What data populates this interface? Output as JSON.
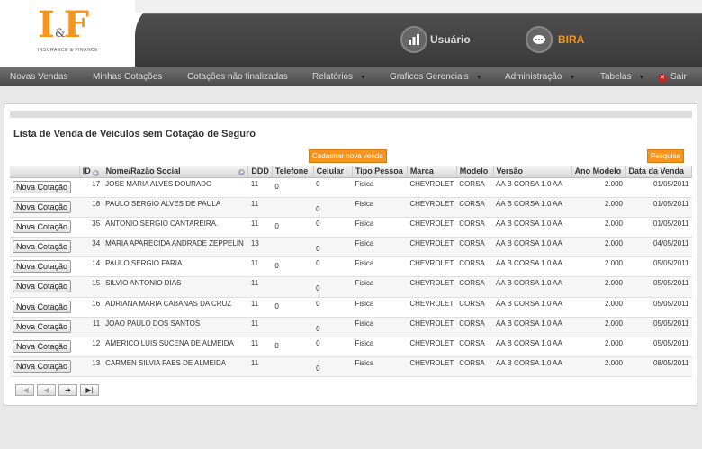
{
  "logo": {
    "mark": "I F",
    "amp": "&",
    "sub": "INSURANCE & FINANCE"
  },
  "header": {
    "user_label": "Usuário",
    "user_name": "BIRA",
    "user_icon": "bar-chart-icon",
    "chat_icon": "chat-bubble-icon",
    "accent": "#f7941d"
  },
  "menu": {
    "items": [
      "Novas Vendas",
      "Minhas Cotações",
      "Cotações não finalizadas",
      "Relatórios",
      "Graficos Gerenciais",
      "Administração",
      "Tabelas",
      "Sair"
    ]
  },
  "page": {
    "title": "Lista de Venda de Veiculos sem Cotação de Seguro",
    "btn_new": "Cadastrar nova venda",
    "btn_search": "Pesquisa",
    "row_button": "Nova Cotação"
  },
  "columns": [
    "",
    "ID",
    "Nome/Razão Social",
    "DDD",
    "Telefone",
    "Celular",
    "Tipo Pessoa",
    "Marca",
    "Modelo",
    "Versão",
    "Ano Modelo",
    "Data da Venda"
  ],
  "rows": [
    {
      "id": "17",
      "nome": "JOSE MARIA ALVES DOURADO",
      "ddd": "11",
      "tel": "0",
      "cel": "0",
      "tipo": "Fisica",
      "marca": "CHEVROLET",
      "modelo": "CORSA",
      "versao": "AA B CORSA 1.0 AA",
      "ano": "2.000",
      "data": "01/05/2011"
    },
    {
      "id": "18",
      "nome": "PAULO SERGIO ALVES DE PAULA",
      "ddd": "11",
      "tel": "",
      "cel": "0",
      "tipo": "Fisica",
      "marca": "CHEVROLET",
      "modelo": "CORSA",
      "versao": "AA B CORSA 1.0 AA",
      "ano": "2.000",
      "data": "01/05/2011"
    },
    {
      "id": "35",
      "nome": "ANTONIO SERGIO CANTAREIRA.",
      "ddd": "11",
      "tel": "0",
      "cel": "0",
      "tipo": "Fisica",
      "marca": "CHEVROLET",
      "modelo": "CORSA",
      "versao": "AA B CORSA 1.0 AA",
      "ano": "2.000",
      "data": "01/05/2011"
    },
    {
      "id": "34",
      "nome": "MARIA APARECIDA ANDRADE ZEPPELIN",
      "ddd": "13",
      "tel": "",
      "cel": "0",
      "tipo": "Fisica",
      "marca": "CHEVROLET",
      "modelo": "CORSA",
      "versao": "AA B CORSA 1.0 AA",
      "ano": "2.000",
      "data": "04/05/2011"
    },
    {
      "id": "14",
      "nome": "PAULO SERGIO FARIA",
      "ddd": "11",
      "tel": "0",
      "cel": "0",
      "tipo": "Fisica",
      "marca": "CHEVROLET",
      "modelo": "CORSA",
      "versao": "AA B CORSA 1.0 AA",
      "ano": "2.000",
      "data": "05/05/2011"
    },
    {
      "id": "15",
      "nome": "SILVIO ANTONIO DIAS",
      "ddd": "11",
      "tel": "",
      "cel": "0",
      "tipo": "Fisica",
      "marca": "CHEVROLET",
      "modelo": "CORSA",
      "versao": "AA B CORSA 1.0 AA",
      "ano": "2.000",
      "data": "05/05/2011"
    },
    {
      "id": "16",
      "nome": "ADRIANA MARIA CABANAS DA CRUZ",
      "ddd": "11",
      "tel": "0",
      "cel": "0",
      "tipo": "Fisica",
      "marca": "CHEVROLET",
      "modelo": "CORSA",
      "versao": "AA B CORSA 1.0 AA",
      "ano": "2.000",
      "data": "05/05/2011"
    },
    {
      "id": "11",
      "nome": "JOAO PAULO DOS SANTOS",
      "ddd": "11",
      "tel": "",
      "cel": "0",
      "tipo": "Fisica",
      "marca": "CHEVROLET",
      "modelo": "CORSA",
      "versao": "AA B CORSA 1.0 AA",
      "ano": "2.000",
      "data": "05/05/2011"
    },
    {
      "id": "12",
      "nome": "AMERICO LUIS SUCENA DE ALMEIDA",
      "ddd": "11",
      "tel": "0",
      "cel": "0",
      "tipo": "Fisica",
      "marca": "CHEVROLET",
      "modelo": "CORSA",
      "versao": "AA B CORSA 1.0 AA",
      "ano": "2.000",
      "data": "05/05/2011"
    },
    {
      "id": "13",
      "nome": "CARMEN SILVIA PAES DE ALMEIDA",
      "ddd": "11",
      "tel": "",
      "cel": "0",
      "tipo": "Fisica",
      "marca": "CHEVROLET",
      "modelo": "CORSA",
      "versao": "AA B CORSA 1.0 AA",
      "ano": "2.000",
      "data": "08/05/2011"
    }
  ],
  "pager": {
    "first": "first-page-icon",
    "prev": "prev-page-icon",
    "next": "next-page-icon",
    "last": "last-page-icon"
  }
}
